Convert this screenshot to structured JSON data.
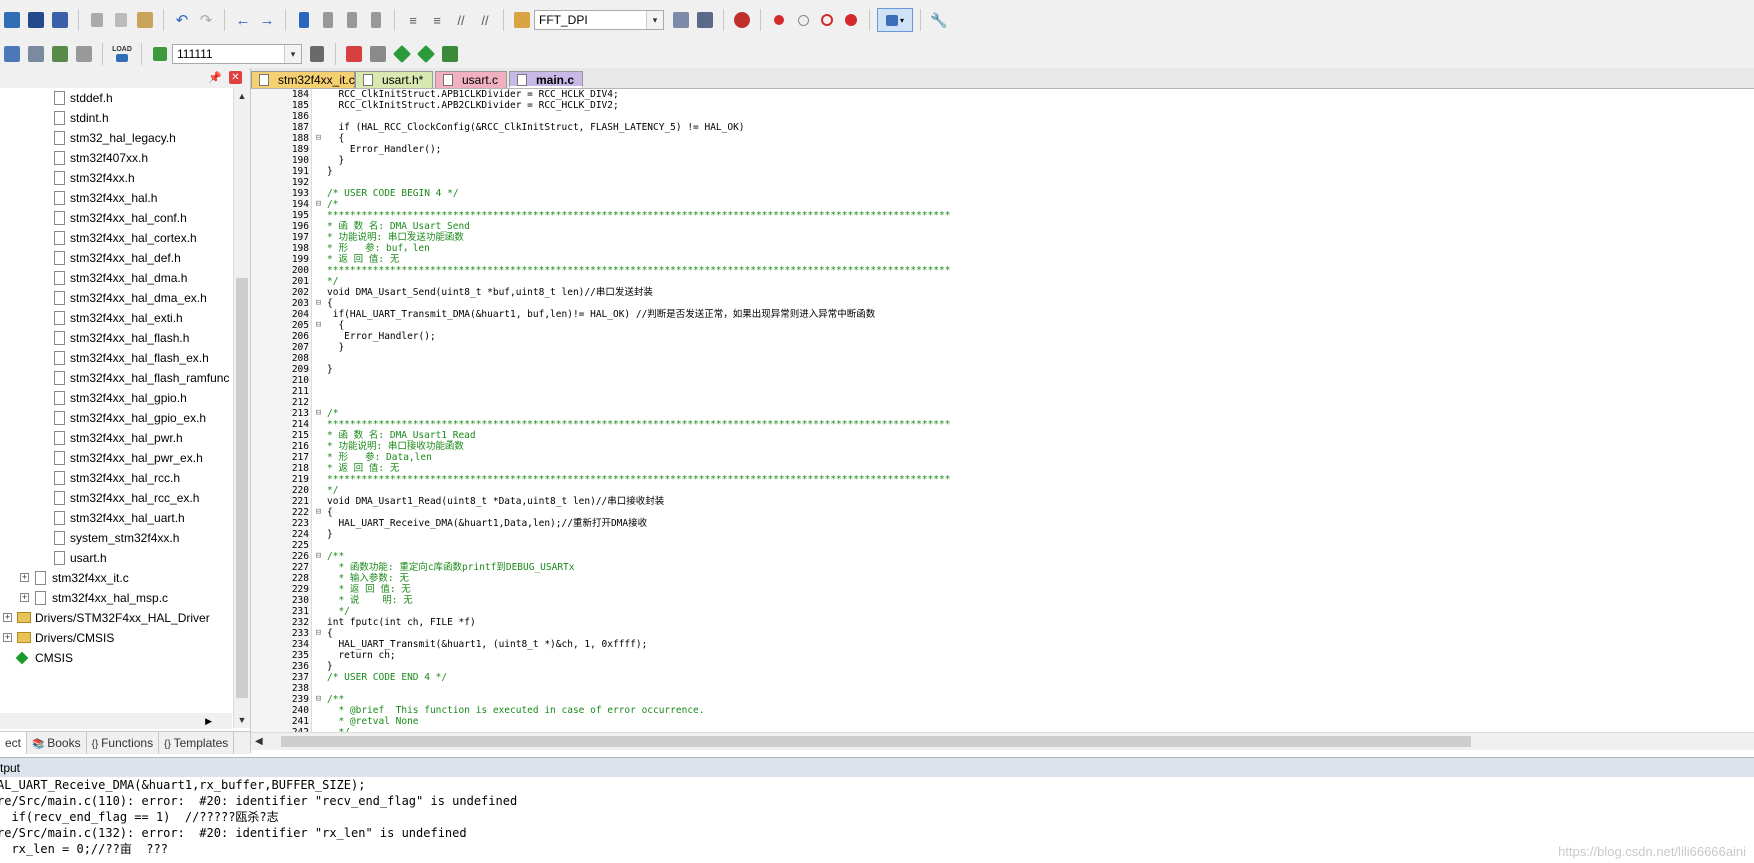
{
  "toolbar1": {
    "target_value": "FFT_DPI",
    "icons": [
      "new-file-icon",
      "save-icon",
      "save-all-icon",
      "cut-icon",
      "copy-icon",
      "paste-icon",
      "undo-icon",
      "redo-icon",
      "nav-back-icon",
      "nav-forward-icon",
      "bookmark-icon",
      "bookmark-prev-icon",
      "bookmark-next-icon",
      "bookmark-clear-icon",
      "indent-icon",
      "unindent-icon",
      "comment-icon",
      "uncomment-icon",
      "find-in-files-icon",
      "debug-start-icon",
      "breakpoint-insert-icon",
      "breakpoint-enable-icon",
      "breakpoint-disable-icon",
      "breakpoint-kill-icon",
      "window-layout-icon",
      "configure-icon"
    ]
  },
  "toolbar2": {
    "load_label": "LOAD",
    "target_value": "111111",
    "icons": [
      "translate-icon",
      "build-icon",
      "rebuild-icon",
      "batch-build-icon",
      "download-icon",
      "target-options-icon",
      "manage-components-icon",
      "run-time-env-icon",
      "pack-installer-icon",
      "select-packs-icon"
    ]
  },
  "project": {
    "files": [
      {
        "label": "stddef.h",
        "indent": 2
      },
      {
        "label": "stdint.h",
        "indent": 2
      },
      {
        "label": "stm32_hal_legacy.h",
        "indent": 2
      },
      {
        "label": "stm32f407xx.h",
        "indent": 2
      },
      {
        "label": "stm32f4xx.h",
        "indent": 2
      },
      {
        "label": "stm32f4xx_hal.h",
        "indent": 2
      },
      {
        "label": "stm32f4xx_hal_conf.h",
        "indent": 2
      },
      {
        "label": "stm32f4xx_hal_cortex.h",
        "indent": 2
      },
      {
        "label": "stm32f4xx_hal_def.h",
        "indent": 2
      },
      {
        "label": "stm32f4xx_hal_dma.h",
        "indent": 2
      },
      {
        "label": "stm32f4xx_hal_dma_ex.h",
        "indent": 2
      },
      {
        "label": "stm32f4xx_hal_exti.h",
        "indent": 2
      },
      {
        "label": "stm32f4xx_hal_flash.h",
        "indent": 2
      },
      {
        "label": "stm32f4xx_hal_flash_ex.h",
        "indent": 2
      },
      {
        "label": "stm32f4xx_hal_flash_ramfunc",
        "indent": 2
      },
      {
        "label": "stm32f4xx_hal_gpio.h",
        "indent": 2
      },
      {
        "label": "stm32f4xx_hal_gpio_ex.h",
        "indent": 2
      },
      {
        "label": "stm32f4xx_hal_pwr.h",
        "indent": 2
      },
      {
        "label": "stm32f4xx_hal_pwr_ex.h",
        "indent": 2
      },
      {
        "label": "stm32f4xx_hal_rcc.h",
        "indent": 2
      },
      {
        "label": "stm32f4xx_hal_rcc_ex.h",
        "indent": 2
      },
      {
        "label": "stm32f4xx_hal_uart.h",
        "indent": 2
      },
      {
        "label": "system_stm32f4xx.h",
        "indent": 2
      },
      {
        "label": "usart.h",
        "indent": 2
      }
    ],
    "nodes": [
      {
        "label": "stm32f4xx_it.c",
        "kind": "file-expand"
      },
      {
        "label": "stm32f4xx_hal_msp.c",
        "kind": "file-expand"
      },
      {
        "label": "Drivers/STM32F4xx_HAL_Driver",
        "kind": "folder"
      },
      {
        "label": "Drivers/CMSIS",
        "kind": "folder"
      },
      {
        "label": "CMSIS",
        "kind": "component"
      }
    ],
    "bottom_tabs": [
      {
        "label": "ect",
        "icon": "project-icon"
      },
      {
        "label": "Books",
        "icon": "books-icon"
      },
      {
        "label": "Functions",
        "icon": "functions-icon"
      },
      {
        "label": "Templates",
        "icon": "templates-icon"
      }
    ]
  },
  "editor": {
    "tabs": [
      {
        "label": "stm32f4xx_it.c",
        "color": "#f4d070",
        "active": false
      },
      {
        "label": "usart.h*",
        "color": "#d8e8b0",
        "active": false
      },
      {
        "label": "usart.c",
        "color": "#f0b0c0",
        "active": false
      },
      {
        "label": "main.c",
        "color": "#c8b8e8",
        "active": true
      }
    ],
    "lines": [
      {
        "n": "184",
        "f": "",
        "t": "  RCC_ClkInitStruct.APB1CLKDivider = RCC_HCLK_DIV4;",
        "c": "n"
      },
      {
        "n": "185",
        "f": "",
        "t": "  RCC_ClkInitStruct.APB2CLKDivider = RCC_HCLK_DIV2;",
        "c": "n"
      },
      {
        "n": "186",
        "f": "",
        "t": "",
        "c": "n"
      },
      {
        "n": "187",
        "f": "",
        "t": "  if (HAL_RCC_ClockConfig(&RCC_ClkInitStruct, FLASH_LATENCY_5) != HAL_OK)",
        "c": "n"
      },
      {
        "n": "188",
        "f": "⊟",
        "t": "  {",
        "c": "n"
      },
      {
        "n": "189",
        "f": "",
        "t": "    Error_Handler();",
        "c": "n"
      },
      {
        "n": "190",
        "f": "",
        "t": "  }",
        "c": "n"
      },
      {
        "n": "191",
        "f": "",
        "t": "}",
        "c": "n"
      },
      {
        "n": "192",
        "f": "",
        "t": "",
        "c": "n"
      },
      {
        "n": "193",
        "f": "",
        "t": "/* USER CODE BEGIN 4 */",
        "c": "c"
      },
      {
        "n": "194",
        "f": "⊟",
        "t": "/*",
        "c": "c"
      },
      {
        "n": "195",
        "f": "",
        "t": "*************************************************************************************************************",
        "c": "c"
      },
      {
        "n": "196",
        "f": "",
        "t": "* 函 数 名: DMA_Usart_Send",
        "c": "c"
      },
      {
        "n": "197",
        "f": "",
        "t": "* 功能说明: 串口发送功能函数",
        "c": "c"
      },
      {
        "n": "198",
        "f": "",
        "t": "* 形   参: buf，len",
        "c": "c"
      },
      {
        "n": "199",
        "f": "",
        "t": "* 返 回 值: 无",
        "c": "c"
      },
      {
        "n": "200",
        "f": "",
        "t": "*************************************************************************************************************",
        "c": "c"
      },
      {
        "n": "201",
        "f": "",
        "t": "*/",
        "c": "c"
      },
      {
        "n": "202",
        "f": "",
        "t": "void DMA_Usart_Send(uint8_t *buf,uint8_t len)//串口发送封装",
        "c": "n"
      },
      {
        "n": "203",
        "f": "⊟",
        "t": "{",
        "c": "n"
      },
      {
        "n": "204",
        "f": "",
        "t": " if(HAL_UART_Transmit_DMA(&huart1, buf,len)!= HAL_OK) //判断是否发送正常，如果出现异常则进入异常中断函数",
        "c": "n"
      },
      {
        "n": "205",
        "f": "⊟",
        "t": "  {",
        "c": "n"
      },
      {
        "n": "206",
        "f": "",
        "t": "   Error_Handler();",
        "c": "n"
      },
      {
        "n": "207",
        "f": "",
        "t": "  }",
        "c": "n"
      },
      {
        "n": "208",
        "f": "",
        "t": "",
        "c": "n"
      },
      {
        "n": "209",
        "f": "",
        "t": "}",
        "c": "n"
      },
      {
        "n": "210",
        "f": "",
        "t": "",
        "c": "n"
      },
      {
        "n": "211",
        "f": "",
        "t": "",
        "c": "n"
      },
      {
        "n": "212",
        "f": "",
        "t": "",
        "c": "n"
      },
      {
        "n": "213",
        "f": "⊟",
        "t": "/*",
        "c": "c"
      },
      {
        "n": "214",
        "f": "",
        "t": "*************************************************************************************************************",
        "c": "c"
      },
      {
        "n": "215",
        "f": "",
        "t": "* 函 数 名: DMA_Usart1_Read",
        "c": "c"
      },
      {
        "n": "216",
        "f": "",
        "t": "* 功能说明: 串口接收功能函数",
        "c": "c"
      },
      {
        "n": "217",
        "f": "",
        "t": "* 形   参: Data,len",
        "c": "c"
      },
      {
        "n": "218",
        "f": "",
        "t": "* 返 回 值: 无",
        "c": "c"
      },
      {
        "n": "219",
        "f": "",
        "t": "*************************************************************************************************************",
        "c": "c"
      },
      {
        "n": "220",
        "f": "",
        "t": "*/",
        "c": "c"
      },
      {
        "n": "221",
        "f": "",
        "t": "void DMA_Usart1_Read(uint8_t *Data,uint8_t len)//串口接收封装",
        "c": "n"
      },
      {
        "n": "222",
        "f": "⊟",
        "t": "{",
        "c": "n"
      },
      {
        "n": "223",
        "f": "",
        "t": "  HAL_UART_Receive_DMA(&huart1,Data,len);//重新打开DMA接收",
        "c": "n"
      },
      {
        "n": "224",
        "f": "",
        "t": "}",
        "c": "n"
      },
      {
        "n": "225",
        "f": "",
        "t": "",
        "c": "n"
      },
      {
        "n": "226",
        "f": "⊟",
        "t": "/**",
        "c": "c"
      },
      {
        "n": "227",
        "f": "",
        "t": "  * 函数功能: 重定向c库函数printf到DEBUG_USARTx",
        "c": "c"
      },
      {
        "n": "228",
        "f": "",
        "t": "  * 输入参数: 无",
        "c": "c"
      },
      {
        "n": "229",
        "f": "",
        "t": "  * 返 回 值: 无",
        "c": "c"
      },
      {
        "n": "230",
        "f": "",
        "t": "  * 说    明: 无",
        "c": "c"
      },
      {
        "n": "231",
        "f": "",
        "t": "  */",
        "c": "c"
      },
      {
        "n": "232",
        "f": "",
        "t": "int fputc(int ch, FILE *f)",
        "c": "n"
      },
      {
        "n": "233",
        "f": "⊟",
        "t": "{",
        "c": "n"
      },
      {
        "n": "234",
        "f": "",
        "t": "  HAL_UART_Transmit(&huart1, (uint8_t *)&ch, 1, 0xffff);",
        "c": "n"
      },
      {
        "n": "235",
        "f": "",
        "t": "  return ch;",
        "c": "n"
      },
      {
        "n": "236",
        "f": "",
        "t": "}",
        "c": "n"
      },
      {
        "n": "237",
        "f": "",
        "t": "/* USER CODE END 4 */",
        "c": "c"
      },
      {
        "n": "238",
        "f": "",
        "t": "",
        "c": "n"
      },
      {
        "n": "239",
        "f": "⊟",
        "t": "/**",
        "c": "c"
      },
      {
        "n": "240",
        "f": "",
        "t": "  * @brief  This function is executed in case of error occurrence.",
        "c": "c"
      },
      {
        "n": "241",
        "f": "",
        "t": "  * @retval None",
        "c": "c"
      },
      {
        "n": "242",
        "f": "",
        "t": "  */",
        "c": "c"
      }
    ]
  },
  "output": {
    "title": "tput",
    "lines": [
      "AL_UART_Receive_DMA(&huart1,rx_buffer,BUFFER_SIZE);",
      "re/Src/main.c(110): error:  #20: identifier \"recv_end_flag\" is undefined",
      "  if(recv_end_flag == 1)  //?????瓯杀?志",
      "re/Src/main.c(132): error:  #20: identifier \"rx_len\" is undefined",
      "  rx_len = 0;//??亩  ???"
    ],
    "watermark": "https://blog.csdn.net/lili66666aini"
  },
  "colors": {
    "comment": "#1a8a1a",
    "toolbar_bg": "#f0f0f0",
    "output_title_bg": "#dde3ec"
  }
}
